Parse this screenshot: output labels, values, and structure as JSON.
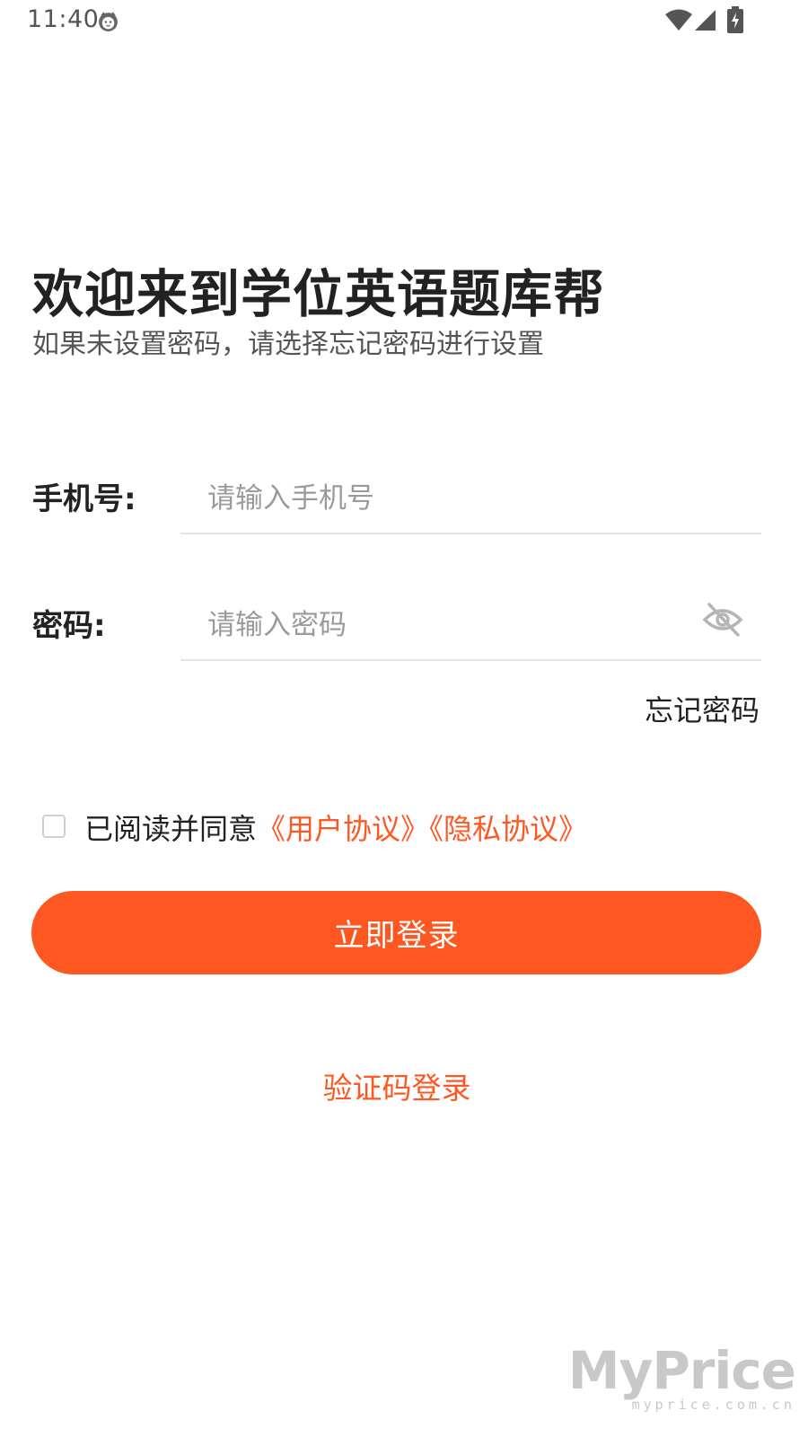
{
  "status_bar": {
    "time": "11:40",
    "icons": [
      "cat-face-icon",
      "wifi-icon",
      "cell-signal-icon",
      "battery-charging-icon"
    ]
  },
  "header": {
    "title": "欢迎来到学位英语题库帮",
    "subtitle": "如果未设置密码，请选择忘记密码进行设置"
  },
  "form": {
    "phone_label": "手机号:",
    "phone_placeholder": "请输入手机号",
    "phone_value": "",
    "password_label": "密码:",
    "password_placeholder": "请输入密码",
    "password_value": "",
    "password_visibility_icon": "eye-off-icon",
    "forgot_password": "忘记密码"
  },
  "agreement": {
    "checked": false,
    "text": "已阅读并同意",
    "user_agreement": "《用户协议》",
    "privacy_agreement": "《隐私协议》"
  },
  "actions": {
    "login_label": "立即登录",
    "code_login_label": "验证码登录"
  },
  "watermark": {
    "logo": "MyPrice",
    "sub": "myprice.com.cn"
  },
  "colors": {
    "accent": "#ff5722",
    "text": "#222222",
    "subtext": "#555555",
    "placeholder": "#9a9a9a",
    "divider": "#e3e3e3"
  }
}
